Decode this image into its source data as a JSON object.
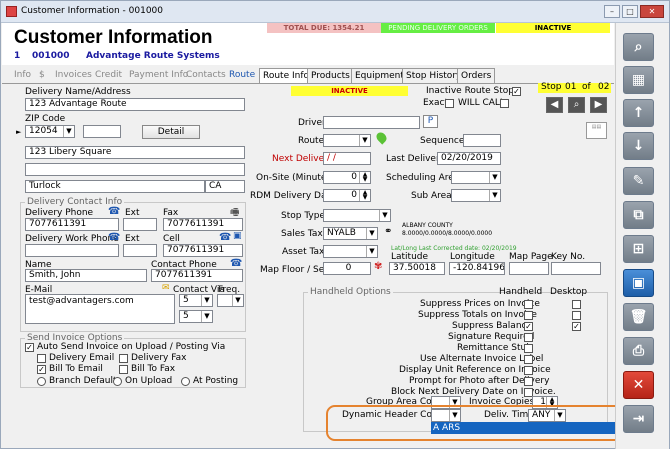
{
  "window": {
    "title": "Customer Information - 001000"
  },
  "header": {
    "title": "Customer Information",
    "number": "1",
    "account": "001000",
    "customer": "Advantage Route Systems",
    "total_due": "TOTAL DUE: 1354.21",
    "pending": "PENDING DELIVERY ORDERS",
    "inactive": "INACTIVE"
  },
  "tabs_left": [
    "Info",
    "$",
    "Invoices",
    "Credit",
    "Payment Info",
    "Contacts",
    "Route"
  ],
  "tabs_right": [
    "Route Info",
    "Products",
    "Equipment",
    "Stop History",
    "Orders"
  ],
  "delivery": {
    "name_label": "Delivery Name/Address",
    "name": "123 Advantage Route",
    "zip_label": "ZIP Code",
    "zip": "12054",
    "detail": "Detail",
    "address": "123 Libery Square",
    "city": "Turlock",
    "state": "CA"
  },
  "contact_info": {
    "title": "Delivery Contact Info",
    "delivery_phone_label": "Delivery Phone",
    "delivery_phone": "7077611391",
    "ext_label": "Ext",
    "fax_label": "Fax",
    "fax": "7077611391",
    "work_phone_label": "Delivery Work Phone",
    "ext2_label": "Ext",
    "cell_label": "Cell",
    "cell": "7077611391",
    "name_label": "Name",
    "name": "Smith, John",
    "contact_phone_label": "Contact Phone",
    "contact_phone": "7077611391",
    "email_label": "E-Mail",
    "email": "test@advantagers.com",
    "contact_via_label": "Contact Via",
    "freq_label": "Freq.",
    "contact_via": "5",
    "freq2": "5"
  },
  "send_invoice": {
    "title": "Send Invoice Options",
    "auto_send": "Auto Send Invoice on Upload / Posting Via",
    "delivery_email": "Delivery Email",
    "delivery_fax": "Delivery Fax",
    "bill_email": "Bill To Email",
    "bill_fax": "Bill To Fax",
    "branch": "Branch Default",
    "upload": "On Upload",
    "posting": "At Posting"
  },
  "route": {
    "inactive": "INACTIVE",
    "inactive_stop": "Inactive Route Stop",
    "exact": "Exact",
    "will_call": "WILL CALL",
    "stop_label": "Stop",
    "stop_num": "01",
    "of": "of",
    "stop_total": "02",
    "driver": "Driver",
    "route": "Route",
    "sequence": "Sequence",
    "next_delivery": "Next Delivery",
    "next_delivery_val": "/ /",
    "last_delivery": "Last Delivery",
    "last_delivery_val": "02/20/2019",
    "onsite": "On-Site (Minutes)",
    "onsite_val": "0",
    "scheduling_area": "Scheduling Area",
    "rdm_days": "RDM Delivery Days",
    "rdm_val": "0",
    "sub_area": "Sub Area",
    "stop_type": "Stop Type",
    "sales_tax": "Sales Tax",
    "sales_tax_val": "NYALB",
    "county": "ALBANY COUNTY",
    "county_rate": "8.0000/0.0000/8.0000/0.0000",
    "asset_tax": "Asset Tax",
    "latlong_note": "Lat/Long Last Corrected date: 02/20/2019",
    "map_floor": "Map Floor / Seq.",
    "map_floor_val": "0",
    "latitude": "Latitude",
    "latitude_val": "37.50018",
    "longitude": "Longitude",
    "longitude_val": "-120.84196",
    "map_page": "Map Page",
    "key_no": "Key No."
  },
  "handheld": {
    "title": "Handheld Options",
    "col_handheld": "Handheld",
    "col_desktop": "Desktop",
    "items": [
      {
        "label": "Suppress Prices on Invoice",
        "hh": "",
        "dt": ""
      },
      {
        "label": "Suppress Totals on Invoice",
        "hh": "",
        "dt": ""
      },
      {
        "label": "Suppress Balance",
        "hh": "✓",
        "dt": "✓"
      },
      {
        "label": "Signature Required",
        "hh": ""
      },
      {
        "label": "Remittance Stub",
        "hh": ""
      },
      {
        "label": "Use Alternate Invoice Label",
        "hh": ""
      },
      {
        "label": "Display Unit Reference on Invoice",
        "hh": ""
      },
      {
        "label": "Prompt for Photo after Delivery",
        "hh": ""
      },
      {
        "label": "Block Next Delivery Date on Invoice.",
        "hh": ""
      }
    ],
    "group_area": "Group Area Code",
    "invoice_copies": "Invoice Copies",
    "invoice_copies_val": "1",
    "dynamic_header": "Dynamic Header Code",
    "deliv_time": "Deliv. Time",
    "deliv_time_val": "ANY",
    "dropdown_option": "A ARS"
  },
  "icons": [
    "search-icon",
    "grid-icon",
    "arrow-up-icon",
    "arrow-down-icon",
    "edit-icon",
    "copy-icon",
    "new-doc-icon",
    "save-icon",
    "trash-icon",
    "print-icon",
    "close-icon",
    "exit-icon"
  ],
  "colors": {
    "total_due_bg": "#f4c2c2",
    "pending_bg": "#66ee44",
    "inactive_bg": "#ffff33",
    "highlight": "#e5832f",
    "nav_blue": "#1565c0"
  }
}
